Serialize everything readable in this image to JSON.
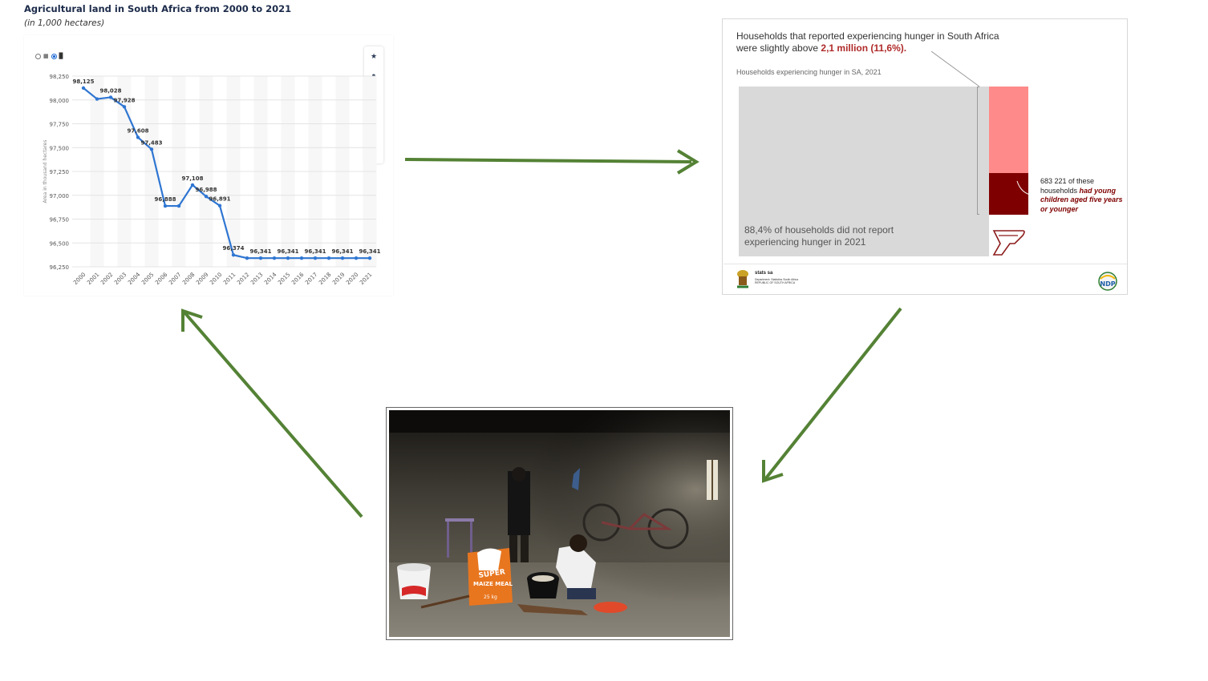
{
  "left_panel": {
    "title": "Agricultural land in South Africa from 2000 to 2021",
    "subtitle": "(in 1,000 hectares)",
    "toggle_icons": [
      "radio-off",
      "table-icon",
      "radio-on",
      "bar-chart-icon"
    ],
    "tools": [
      "star-icon",
      "bell-icon",
      "gear-icon",
      "share-icon",
      "quote-icon",
      "print-icon"
    ]
  },
  "chart_data": {
    "type": "line",
    "title": "Agricultural land in South Africa from 2000 to 2021",
    "subtitle": "(in 1,000 hectares)",
    "xlabel": "",
    "ylabel": "Area in thousand hectares",
    "x": [
      "2000",
      "2001",
      "2002",
      "2003",
      "2004",
      "2005",
      "2006",
      "2007",
      "2008",
      "2009",
      "2010",
      "2011",
      "2012",
      "2013",
      "2014",
      "2015",
      "2016",
      "2017",
      "2018",
      "2019",
      "2020",
      "2021"
    ],
    "values": [
      98125,
      98010,
      98028,
      97928,
      97608,
      97483,
      96888,
      96888,
      97108,
      96988,
      96891,
      96374,
      96341,
      96341,
      96341,
      96341,
      96341,
      96341,
      96341,
      96341,
      96341,
      96341
    ],
    "data_labels": [
      {
        "x": "2000",
        "text": "98,125"
      },
      {
        "x": "2002",
        "text": "98,028"
      },
      {
        "x": "2003",
        "text": "97,928"
      },
      {
        "x": "2004",
        "text": "97,608"
      },
      {
        "x": "2005",
        "text": "97,483"
      },
      {
        "x": "2006",
        "text": "96,888"
      },
      {
        "x": "2008",
        "text": "97,108"
      },
      {
        "x": "2009",
        "text": "96,988"
      },
      {
        "x": "2010",
        "text": "96,891"
      },
      {
        "x": "2011",
        "text": "96,374"
      },
      {
        "x": "2013",
        "text": "96,341"
      },
      {
        "x": "2015",
        "text": "96,341"
      },
      {
        "x": "2017",
        "text": "96,341"
      },
      {
        "x": "2019",
        "text": "96,341"
      },
      {
        "x": "2021",
        "text": "96,341"
      }
    ],
    "y_ticks": [
      "98,250",
      "98,000",
      "97,750",
      "97,500",
      "97,250",
      "97,000",
      "96,750",
      "96,500",
      "96,250"
    ],
    "ylim": [
      96250,
      98250
    ],
    "grid": true,
    "line_color": "#2f76d2"
  },
  "right_panel": {
    "headline_prefix": "Households that reported experiencing hunger in South Africa were slightly above ",
    "headline_highlight": "2,1 million (11,6%).",
    "subtitle": "Households experiencing hunger in SA,  2021",
    "not_hungry_note": "88,4% of households did not report experiencing hunger in 2021",
    "children_note_prefix": "683 221 of these households ",
    "children_note_emphasis": "had young children aged five years or younger",
    "hungry_share_percent": 11.6,
    "not_hungry_share_percent": 88.4,
    "colors": {
      "grey": "#d9d9d9",
      "pink": "#ff8a8a",
      "dark_red": "#7f0000",
      "highlight": "#b02a2a"
    },
    "logo_stats_name": "stats sa",
    "logo_stats_sub": "Department: Statistics South Africa REPUBLIC OF SOUTH AFRICA",
    "logo_ndp": "NDP"
  },
  "photo": {
    "bag_brand": "SUPER",
    "bag_product": "MAIZE MEAL",
    "bag_weight": "25 kg"
  },
  "arrows": {
    "color": "#548235"
  }
}
